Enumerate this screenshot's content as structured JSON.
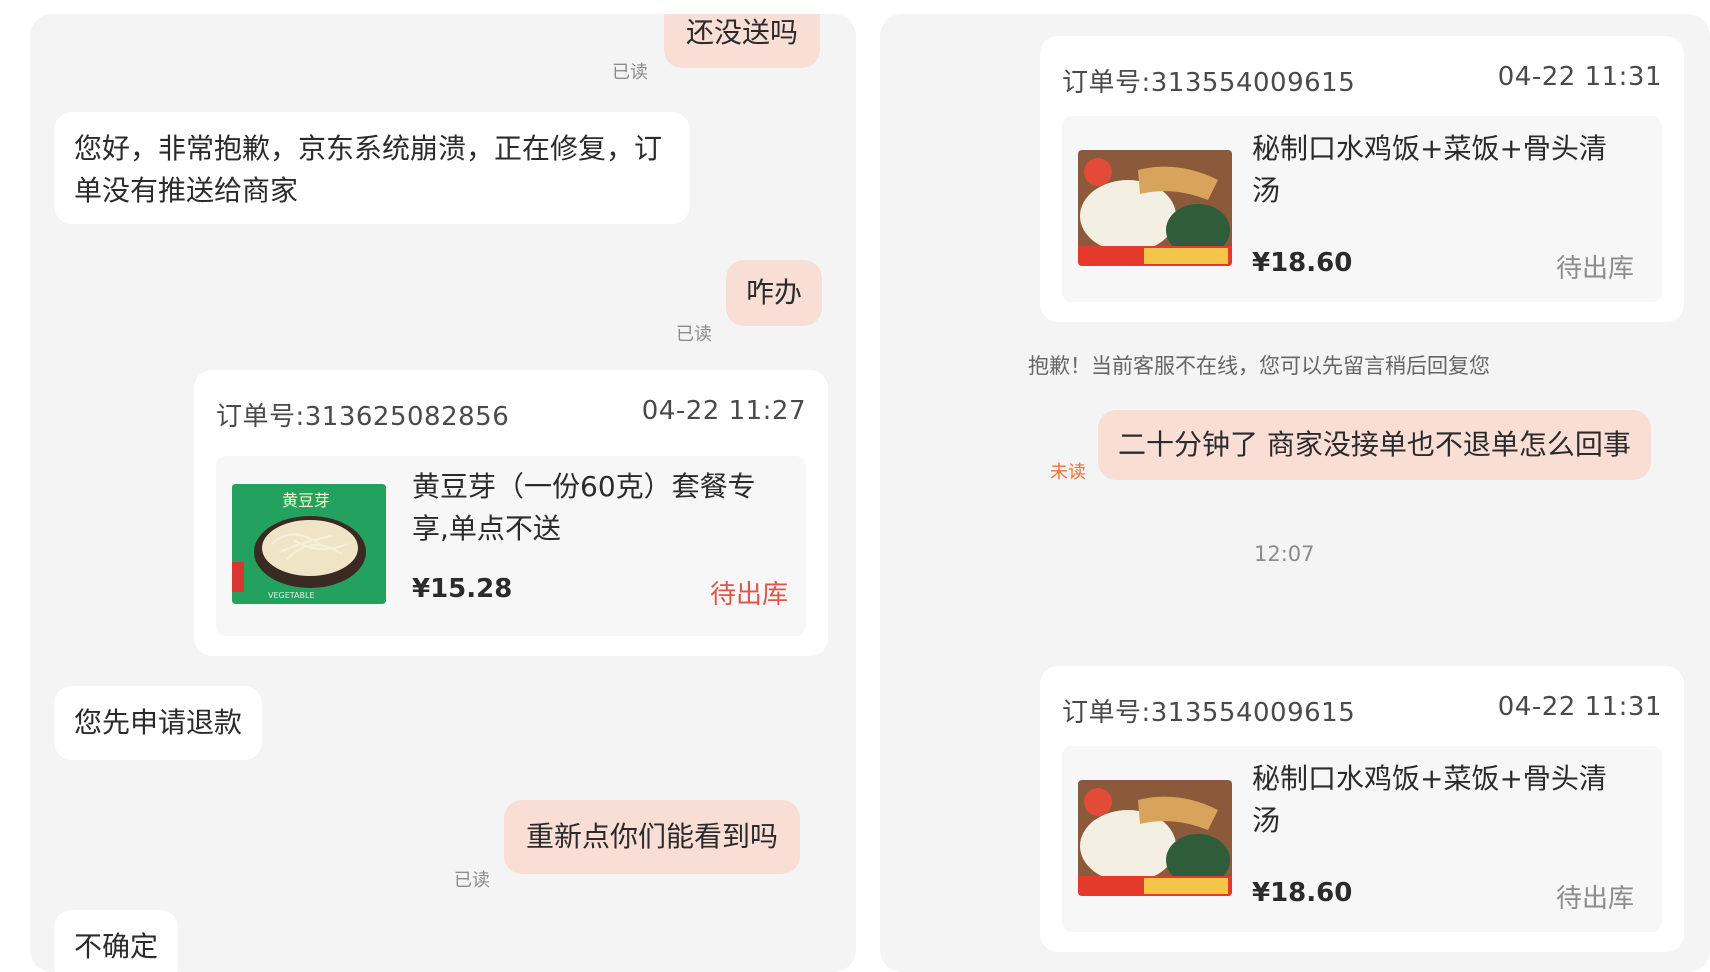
{
  "left": {
    "msg1": {
      "text": "还没送吗",
      "read_label": "已读"
    },
    "msg2": {
      "text": "您好，非常抱歉，京东系统崩溃，正在修复，订单没有推送给商家"
    },
    "msg3": {
      "text": "咋办",
      "read_label": "已读"
    },
    "order": {
      "order_no": "订单号:313625082856",
      "time": "04-22 11:27",
      "product_name": "黄豆芽（一份60克）套餐专享,单点不送",
      "price": "¥15.28",
      "status": "待出库",
      "thumb_title": "黄豆芽",
      "thumb_caption": "VEGETABLE"
    },
    "msg4": {
      "text": "您先申请退款"
    },
    "msg5": {
      "text": "重新点你们能看到吗",
      "read_label": "已读"
    },
    "msg6": {
      "text": "不确定"
    }
  },
  "right": {
    "order1": {
      "order_no": "订单号:313554009615",
      "time": "04-22 11:31",
      "product_name": "秘制口水鸡饭+菜饭+骨头清汤",
      "price": "¥18.60",
      "status": "待出库"
    },
    "system_notice": "抱歉！当前客服不在线，您可以先留言稍后回复您",
    "msg1": {
      "text": "二十分钟了 商家没接单也不退单怎么回事",
      "read_label": "未读"
    },
    "timestamp": "12:07",
    "order2": {
      "order_no": "订单号:313554009615",
      "time": "04-22 11:31",
      "product_name": "秘制口水鸡饭+菜饭+骨头清汤",
      "price": "¥18.60",
      "status": "待出库"
    }
  },
  "colors": {
    "outgoing_bubble": "#f9ded6",
    "incoming_bubble": "#ffffff",
    "pane_bg": "#f4f4f4",
    "status_red": "#e2534a",
    "unread_orange": "#e8743b"
  }
}
